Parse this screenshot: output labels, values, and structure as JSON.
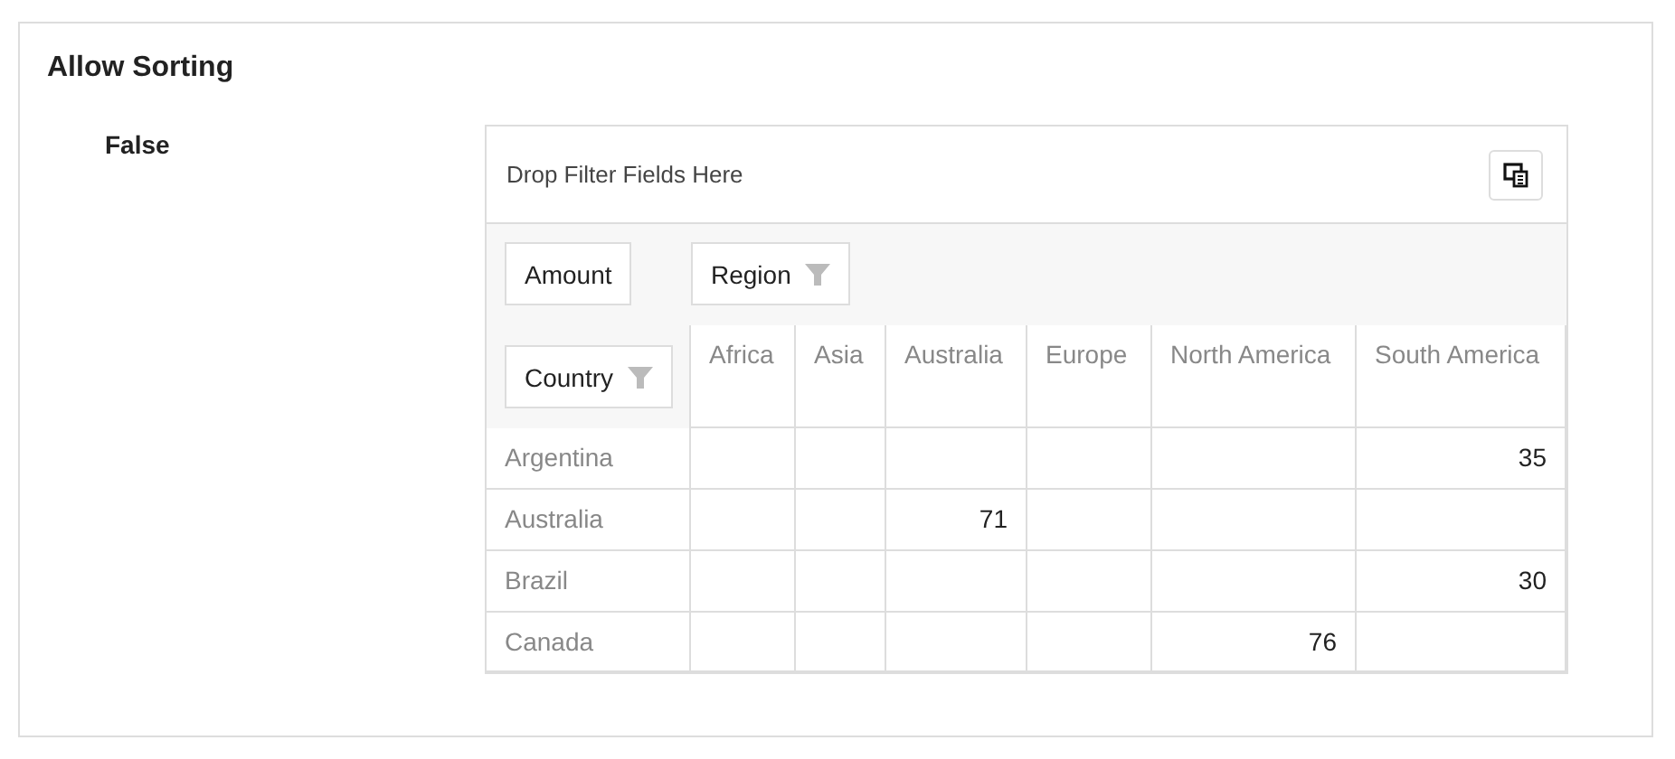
{
  "section_title": "Allow Sorting",
  "option_label": "False",
  "pivot": {
    "filter_area": {
      "hint_text": "Drop Filter Fields Here"
    },
    "value_field": {
      "label": "Amount",
      "filter": false
    },
    "column_field": {
      "label": "Region",
      "filter": true
    },
    "row_field": {
      "label": "Country",
      "filter": true
    },
    "columns": [
      "Africa",
      "Asia",
      "Australia",
      "Europe",
      "North America",
      "South America"
    ],
    "rows": [
      {
        "label": "Argentina",
        "cells": [
          {
            "kind": "empty"
          },
          {
            "kind": "empty"
          },
          {
            "kind": "empty"
          },
          {
            "kind": "empty"
          },
          {
            "kind": "empty"
          },
          {
            "kind": "value",
            "text": "35"
          }
        ]
      },
      {
        "label": "Australia",
        "cells": [
          {
            "kind": "empty"
          },
          {
            "kind": "empty"
          },
          {
            "kind": "value",
            "text": "71"
          },
          {
            "kind": "empty"
          },
          {
            "kind": "empty"
          },
          {
            "kind": "empty"
          }
        ]
      },
      {
        "label": "Brazil",
        "cells": [
          {
            "kind": "empty"
          },
          {
            "kind": "empty"
          },
          {
            "kind": "empty"
          },
          {
            "kind": "empty"
          },
          {
            "kind": "empty"
          },
          {
            "kind": "value",
            "text": "30"
          }
        ]
      },
      {
        "label": "Canada",
        "cells": [
          {
            "kind": "empty"
          },
          {
            "kind": "empty"
          },
          {
            "kind": "empty"
          },
          {
            "kind": "empty"
          },
          {
            "kind": "value",
            "text": "76"
          },
          {
            "kind": "empty"
          }
        ]
      }
    ]
  }
}
